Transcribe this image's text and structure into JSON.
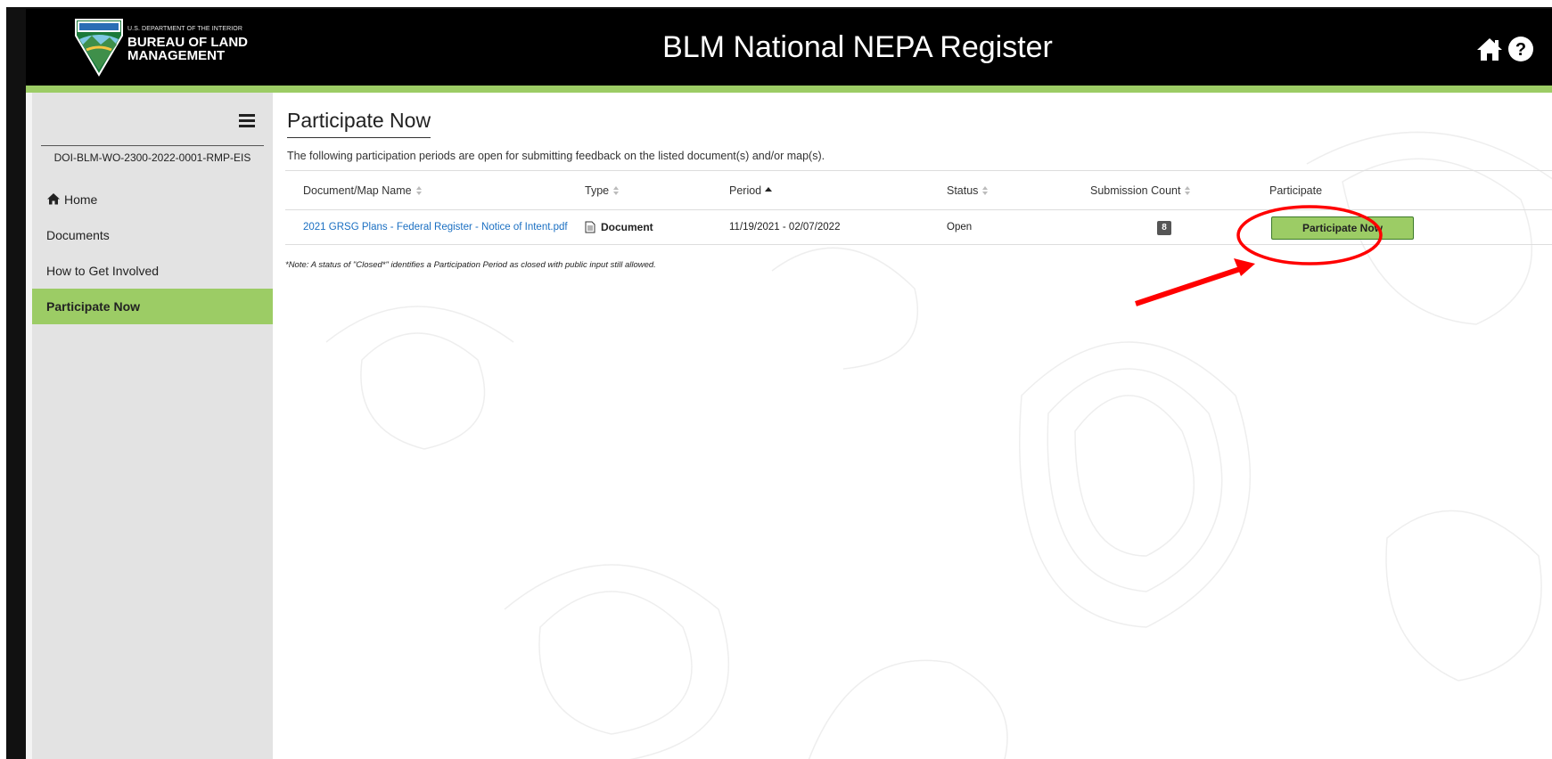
{
  "header": {
    "logo_department": "U.S. DEPARTMENT OF THE INTERIOR",
    "logo_line1": "BUREAU OF LAND",
    "logo_line2": "MANAGEMENT",
    "title": "BLM National NEPA Register",
    "icons": [
      "home-icon",
      "help-icon"
    ]
  },
  "sidebar": {
    "project_id": "DOI-BLM-WO-2300-2022-0001-RMP-EIS",
    "items": [
      {
        "label": "Home",
        "icon": "home-icon",
        "active": false
      },
      {
        "label": "Documents",
        "active": false
      },
      {
        "label": "How to Get Involved",
        "active": false
      },
      {
        "label": "Participate Now",
        "active": true
      }
    ]
  },
  "main": {
    "title": "Participate Now",
    "intro": "The following participation periods are open for submitting feedback on the listed document(s) and/or map(s).",
    "columns": [
      "Document/Map Name",
      "Type",
      "Period",
      "Status",
      "Submission Count",
      "Participate"
    ],
    "rows": [
      {
        "name": "2021 GRSG Plans - Federal Register - Notice of Intent.pdf",
        "type": "Document",
        "period": "11/19/2021 - 02/07/2022",
        "status": "Open",
        "submission_count": "8",
        "action": "Participate Now"
      }
    ],
    "note": "*Note: A status of \"Closed*\" identifies a Participation Period as closed with public input still allowed."
  },
  "colors": {
    "accent_green": "#9ccc65",
    "header_black": "#000000",
    "link_blue": "#1a6fc2",
    "annotation_red": "#ff0000"
  }
}
